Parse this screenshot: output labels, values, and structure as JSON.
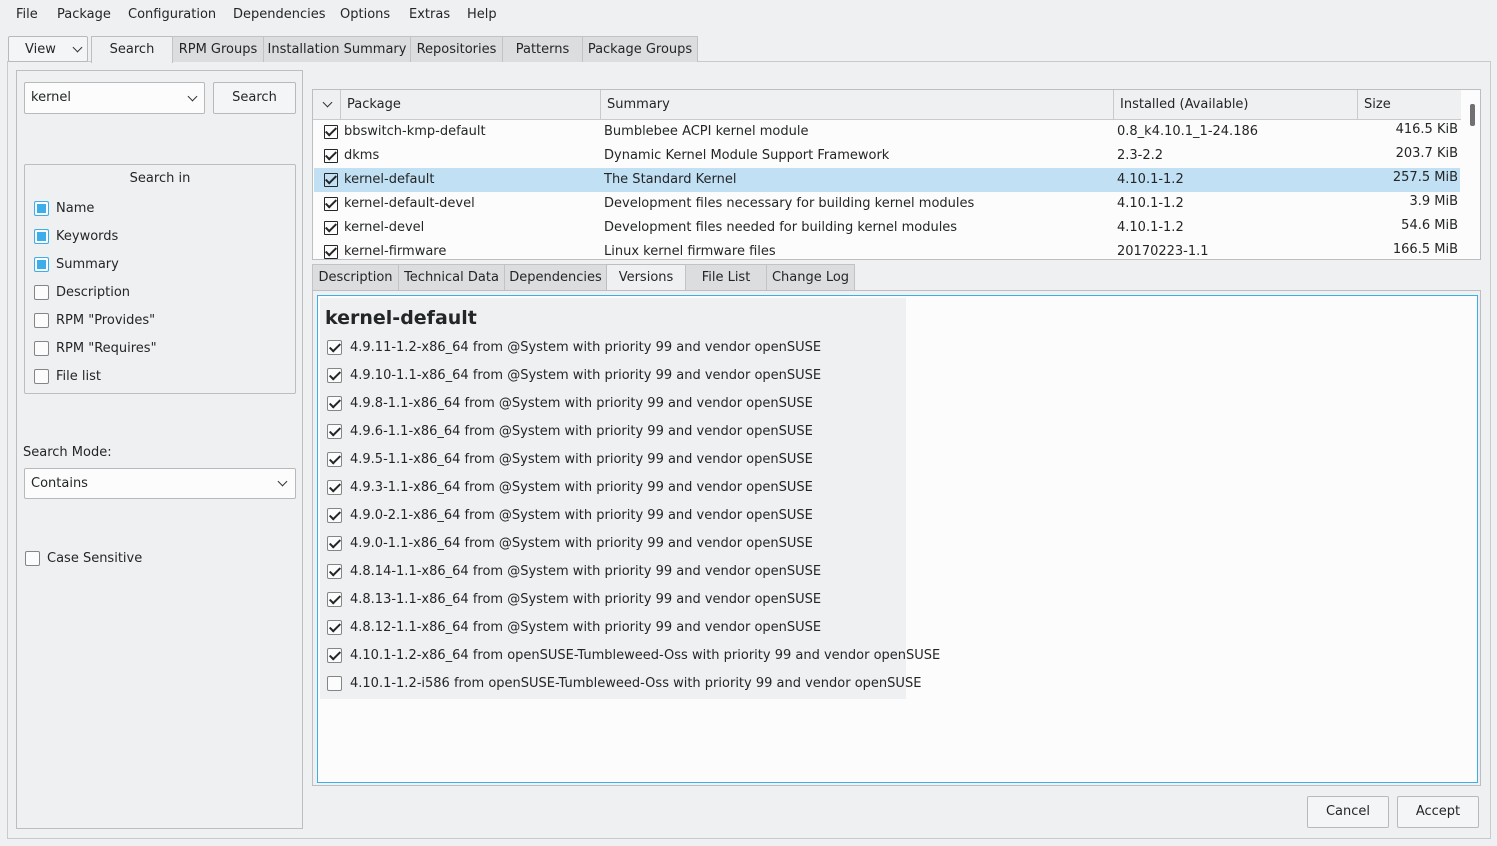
{
  "menu": [
    "File",
    "Package",
    "Configuration",
    "Dependencies",
    "Options",
    "Extras",
    "Help"
  ],
  "view_button": "View",
  "top_tabs": [
    "Search",
    "RPM Groups",
    "Installation Summary",
    "Repositories",
    "Patterns",
    "Package Groups"
  ],
  "search": {
    "query": "kernel",
    "button": "Search",
    "search_in_title": "Search in",
    "options": [
      {
        "label": "Name",
        "checked": true
      },
      {
        "label": "Keywords",
        "checked": true
      },
      {
        "label": "Summary",
        "checked": true
      },
      {
        "label": "Description",
        "checked": false
      },
      {
        "label": "RPM \"Provides\"",
        "checked": false
      },
      {
        "label": "RPM \"Requires\"",
        "checked": false
      },
      {
        "label": "File list",
        "checked": false
      }
    ],
    "mode_label": "Search Mode:",
    "mode_value": "Contains",
    "case_sensitive": "Case Sensitive"
  },
  "table": {
    "headers": [
      "Package",
      "Summary",
      "Installed (Available)",
      "Size"
    ],
    "rows": [
      {
        "package": "bbswitch-kmp-default",
        "summary": "Bumblebee ACPI kernel module",
        "installed": "0.8_k4.10.1_1-24.186",
        "size": "416.5 KiB"
      },
      {
        "package": "dkms",
        "summary": "Dynamic Kernel Module Support Framework",
        "installed": "2.3-2.2",
        "size": "203.7 KiB"
      },
      {
        "package": "kernel-default",
        "summary": "The Standard Kernel",
        "installed": "4.10.1-1.2",
        "size": "257.5 MiB"
      },
      {
        "package": "kernel-default-devel",
        "summary": "Development files necessary for building kernel modules",
        "installed": "4.10.1-1.2",
        "size": "3.9 MiB"
      },
      {
        "package": "kernel-devel",
        "summary": "Development files needed for building kernel modules",
        "installed": "4.10.1-1.2",
        "size": "54.6 MiB"
      },
      {
        "package": "kernel-firmware",
        "summary": "Linux kernel firmware files",
        "installed": "20170223-1.1",
        "size": "166.5 MiB"
      }
    ]
  },
  "detail_tabs": [
    "Description",
    "Technical Data",
    "Dependencies",
    "Versions",
    "File List",
    "Change Log"
  ],
  "versions": {
    "title": "kernel-default",
    "items": [
      {
        "label": "4.9.11-1.2-x86_64 from @System with priority 99 and vendor openSUSE",
        "checked": true
      },
      {
        "label": "4.9.10-1.1-x86_64 from @System with priority 99 and vendor openSUSE",
        "checked": true
      },
      {
        "label": "4.9.8-1.1-x86_64 from @System with priority 99 and vendor openSUSE",
        "checked": true
      },
      {
        "label": "4.9.6-1.1-x86_64 from @System with priority 99 and vendor openSUSE",
        "checked": true
      },
      {
        "label": "4.9.5-1.1-x86_64 from @System with priority 99 and vendor openSUSE",
        "checked": true
      },
      {
        "label": "4.9.3-1.1-x86_64 from @System with priority 99 and vendor openSUSE",
        "checked": true
      },
      {
        "label": "4.9.0-2.1-x86_64 from @System with priority 99 and vendor openSUSE",
        "checked": true
      },
      {
        "label": "4.9.0-1.1-x86_64 from @System with priority 99 and vendor openSUSE",
        "checked": true
      },
      {
        "label": "4.8.14-1.1-x86_64 from @System with priority 99 and vendor openSUSE",
        "checked": true
      },
      {
        "label": "4.8.13-1.1-x86_64 from @System with priority 99 and vendor openSUSE",
        "checked": true
      },
      {
        "label": "4.8.12-1.1-x86_64 from @System with priority 99 and vendor openSUSE",
        "checked": true
      },
      {
        "label": "4.10.1-1.2-x86_64 from openSUSE-Tumbleweed-Oss with priority 99 and vendor openSUSE",
        "checked": true
      },
      {
        "label": "4.10.1-1.2-i586 from openSUSE-Tumbleweed-Oss with priority 99 and vendor openSUSE",
        "checked": false
      }
    ]
  },
  "footer": {
    "cancel": "Cancel",
    "accept": "Accept"
  },
  "colors": {
    "accent": "#3daee9",
    "selection": "#c2e0f4",
    "window_bg": "#eff0f1"
  }
}
